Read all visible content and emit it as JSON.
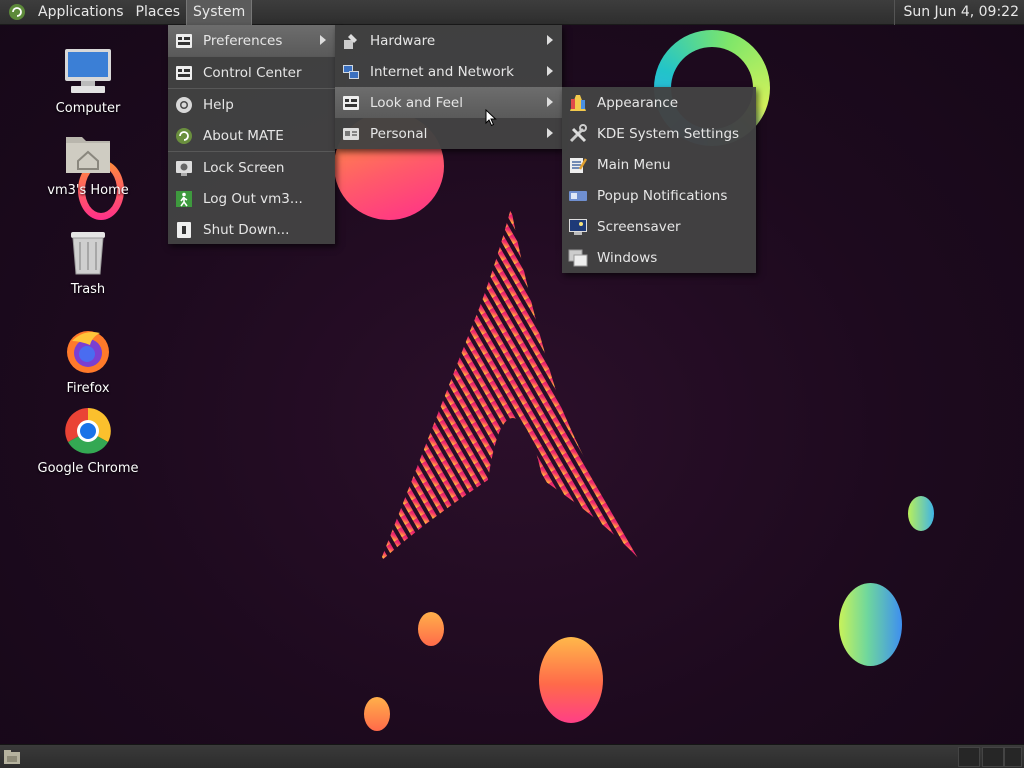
{
  "top_panel": {
    "menus": [
      "Applications",
      "Places",
      "System"
    ],
    "clock": "Sun Jun  4, 09:22"
  },
  "desktop_icons": [
    {
      "label": "Computer",
      "icon": "computer-icon"
    },
    {
      "label": "vm3's Home",
      "icon": "home-folder-icon"
    },
    {
      "label": "Trash",
      "icon": "trash-icon"
    },
    {
      "label": "Firefox",
      "icon": "firefox-icon"
    },
    {
      "label": "Google Chrome",
      "icon": "chrome-icon"
    }
  ],
  "system_menu": {
    "items": [
      "Preferences",
      "Control Center",
      "Help",
      "About MATE",
      "Lock Screen",
      "Log Out vm3...",
      "Shut Down..."
    ]
  },
  "preferences_menu": {
    "items": [
      "Hardware",
      "Internet and Network",
      "Look and Feel",
      "Personal"
    ]
  },
  "look_and_feel_menu": {
    "items": [
      "Appearance",
      "KDE System Settings",
      "Main Menu",
      "Popup Notifications",
      "Screensaver",
      "Windows"
    ]
  },
  "colors": {
    "menu_bg": "#424242",
    "highlight": "#626262",
    "desktop_bg": "#1d0a1e",
    "accent_pink": "#e8306a",
    "accent_orange": "#ff8a3d"
  }
}
